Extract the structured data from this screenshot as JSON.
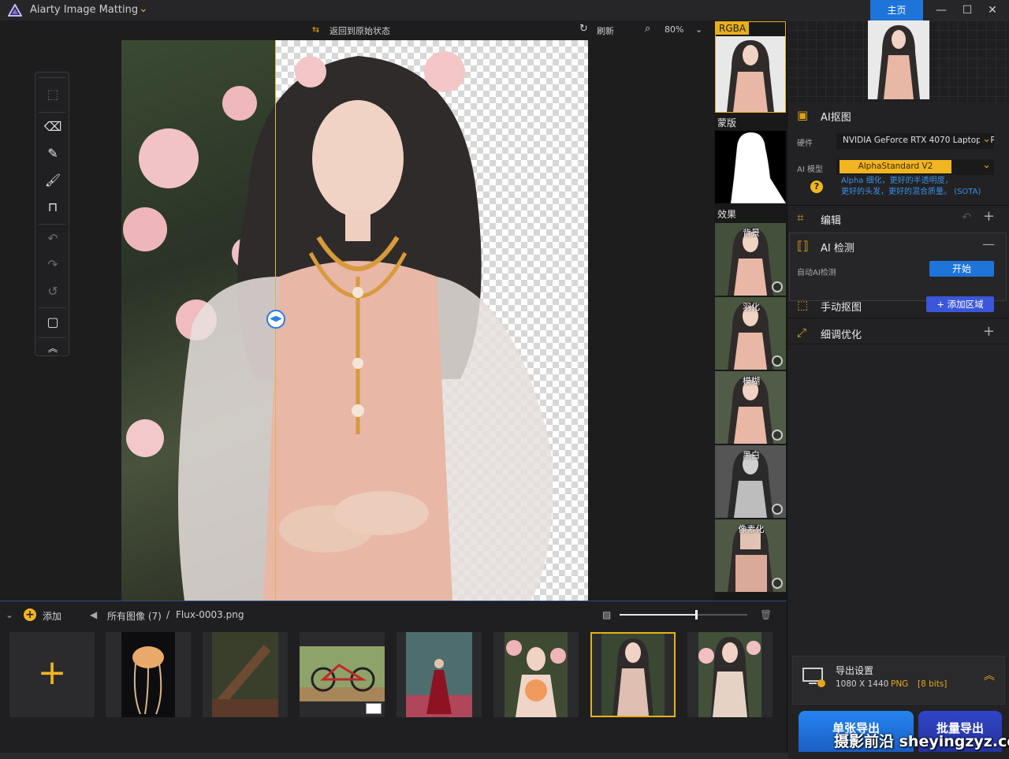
{
  "titlebar": {
    "app_title": "Aiarty Image Matting",
    "home_label": "主页",
    "minimize": "—",
    "maximize": "☐",
    "close": "✕"
  },
  "canvas_toolbar": {
    "reset_label": "返回到原始状态",
    "refresh_label": "刷新",
    "zoom_value": "80%"
  },
  "preview_strip": {
    "rgba_label": "RGBA",
    "mask_label": "蒙版",
    "effects_label": "效果",
    "effects": [
      {
        "label": "背景"
      },
      {
        "label": "羽化"
      },
      {
        "label": "模糊"
      },
      {
        "label": "黑白"
      },
      {
        "label": "像素化"
      }
    ]
  },
  "right_panel": {
    "ai_matting": {
      "title": "AI抠图",
      "hardware_label": "硬件",
      "hardware_value": "NVIDIA GeForce RTX 4070 Laptop GPU",
      "model_label": "AI 模型",
      "model_value": "AlphaStandard  V2",
      "model_desc_line1": "Alpha 细化，更好的半透明度，",
      "model_desc_line2": "更好的头发，更好的混合质量。 (SOTA)",
      "help": "?"
    },
    "edit": {
      "title": "编辑"
    },
    "ai_detect": {
      "title": "AI 检测",
      "auto_label": "自动AI检测",
      "start_label": "开始"
    },
    "manual": {
      "title": "手动抠图",
      "add_region_label": "+ 添加区域"
    },
    "refine": {
      "title": "细调优化"
    },
    "export": {
      "title": "导出设置",
      "resolution": "1080 X 1440",
      "format": "PNG",
      "bits": "[8 bits]",
      "single_label": "单张导出",
      "batch_label": "批量导出"
    }
  },
  "gallery": {
    "add_label": "添加",
    "breadcrumb_all": "所有图像 (7)",
    "breadcrumb_sep": "/",
    "breadcrumb_file": "Flux-0003.png",
    "zoom_fraction": 0.6,
    "tiles": [
      {
        "name": "jellyfish"
      },
      {
        "name": "forest-log"
      },
      {
        "name": "bicycle"
      },
      {
        "name": "red-dress-forest"
      },
      {
        "name": "girl-with-flowers"
      },
      {
        "name": "flux-0003",
        "selected": true
      },
      {
        "name": "girl-flowers-2"
      }
    ]
  },
  "watermark": "摄影前沿 sheyingzyz.com",
  "colors": {
    "accent": "#f1b521",
    "primary_blue": "#1e74d9",
    "selected_border": "#e8b018"
  }
}
